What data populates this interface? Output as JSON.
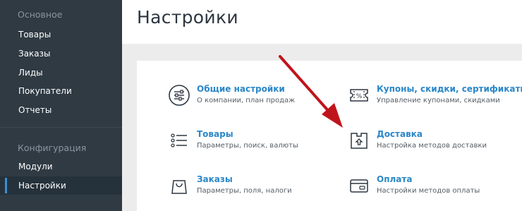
{
  "sidebar": {
    "groups": [
      {
        "title": "Основное",
        "items": [
          {
            "label": "Товары"
          },
          {
            "label": "Заказы"
          },
          {
            "label": "Лиды"
          },
          {
            "label": "Покупатели"
          },
          {
            "label": "Отчеты"
          }
        ]
      },
      {
        "title": "Конфигурация",
        "items": [
          {
            "label": "Модули"
          },
          {
            "label": "Настройки",
            "active": true
          }
        ]
      }
    ]
  },
  "header": {
    "title": "Настройки"
  },
  "settings": [
    {
      "icon": "sliders-icon",
      "title": "Общие настройки",
      "description": "О компании, план продаж"
    },
    {
      "icon": "coupon-icon",
      "title": "Купоны, скидки, сертификаты",
      "description": "Управление купонами, скидками"
    },
    {
      "icon": "list-icon",
      "title": "Товары",
      "description": "Параметры, поиск, валюты"
    },
    {
      "icon": "delivery-box-icon",
      "title": "Доставка",
      "description": "Настройка методов доставки"
    },
    {
      "icon": "shopping-bag-icon",
      "title": "Заказы",
      "description": "Параметры, поля, налоги"
    },
    {
      "icon": "credit-card-icon",
      "title": "Оплата",
      "description": "Настройки методов оплаты"
    }
  ],
  "colors": {
    "sidebar_bg": "#2f3a43",
    "accent": "#3b8fd6",
    "link": "#2a87c8",
    "annotation_arrow": "#c0141b"
  }
}
